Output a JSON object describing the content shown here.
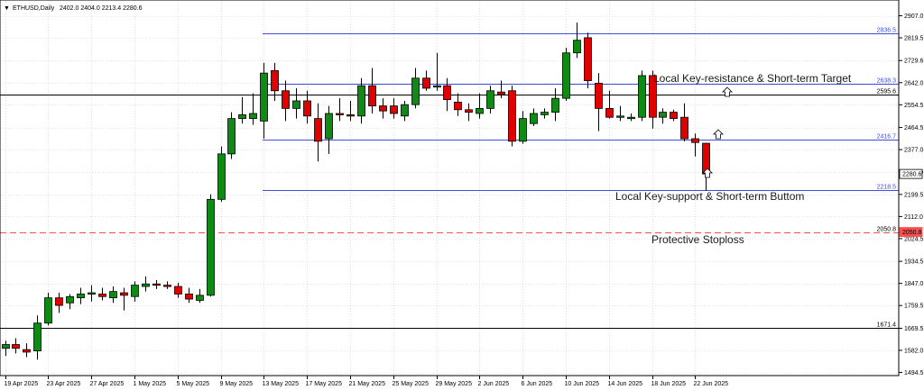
{
  "header": {
    "symbol_label": "ETHUSD,Daily",
    "ohlc_label": "2402.0 2404.0 2213.4 2280.6"
  },
  "chart_data": {
    "type": "candlestick",
    "symbol": "ETHUSD",
    "timeframe": "Daily",
    "ylim": [
      1471,
      2925
    ],
    "y_ticks": [
      2907.0,
      2819.5,
      2729.6,
      2642.0,
      2554.5,
      2464.5,
      2377.0,
      2289.5,
      2199.5,
      2112.0,
      2024.5,
      1934.5,
      1847.0,
      1759.5,
      1669.5,
      1582.0,
      1494.5
    ],
    "x_labels": [
      "19 Apr 2025",
      "23 Apr 2025",
      "27 Apr 2025",
      "1 May 2025",
      "5 May 2025",
      "9 May 2025",
      "13 May 2025",
      "17 May 2025",
      "21 May 2025",
      "25 May 2025",
      "29 May 2025",
      "2 Jun 2025",
      "6 Jun 2025",
      "10 Jun 2025",
      "14 Jun 2025",
      "18 Jun 2025",
      "22 Jun 2025"
    ],
    "candles": [
      {
        "date": "2025-04-18",
        "o": 1590,
        "h": 1620,
        "l": 1560,
        "c": 1605
      },
      {
        "date": "2025-04-19",
        "o": 1605,
        "h": 1630,
        "l": 1570,
        "c": 1590
      },
      {
        "date": "2025-04-20",
        "o": 1585,
        "h": 1610,
        "l": 1555,
        "c": 1575
      },
      {
        "date": "2025-04-21",
        "o": 1580,
        "h": 1720,
        "l": 1545,
        "c": 1690
      },
      {
        "date": "2025-04-22",
        "o": 1690,
        "h": 1810,
        "l": 1680,
        "c": 1790
      },
      {
        "date": "2025-04-23",
        "o": 1790,
        "h": 1810,
        "l": 1730,
        "c": 1760
      },
      {
        "date": "2025-04-24",
        "o": 1770,
        "h": 1805,
        "l": 1745,
        "c": 1795
      },
      {
        "date": "2025-04-25",
        "o": 1790,
        "h": 1830,
        "l": 1765,
        "c": 1805
      },
      {
        "date": "2025-04-26",
        "o": 1805,
        "h": 1840,
        "l": 1775,
        "c": 1810
      },
      {
        "date": "2025-04-27",
        "o": 1805,
        "h": 1830,
        "l": 1780,
        "c": 1795
      },
      {
        "date": "2025-04-28",
        "o": 1790,
        "h": 1835,
        "l": 1770,
        "c": 1815
      },
      {
        "date": "2025-04-29",
        "o": 1810,
        "h": 1830,
        "l": 1740,
        "c": 1800
      },
      {
        "date": "2025-04-30",
        "o": 1795,
        "h": 1855,
        "l": 1775,
        "c": 1840
      },
      {
        "date": "2025-05-01",
        "o": 1835,
        "h": 1875,
        "l": 1815,
        "c": 1845
      },
      {
        "date": "2025-05-02",
        "o": 1845,
        "h": 1860,
        "l": 1825,
        "c": 1840
      },
      {
        "date": "2025-05-03",
        "o": 1840,
        "h": 1855,
        "l": 1825,
        "c": 1835
      },
      {
        "date": "2025-05-04",
        "o": 1835,
        "h": 1850,
        "l": 1790,
        "c": 1805
      },
      {
        "date": "2025-05-05",
        "o": 1805,
        "h": 1830,
        "l": 1770,
        "c": 1785
      },
      {
        "date": "2025-05-06",
        "o": 1780,
        "h": 1825,
        "l": 1770,
        "c": 1800
      },
      {
        "date": "2025-05-07",
        "o": 1800,
        "h": 2200,
        "l": 1795,
        "c": 2180
      },
      {
        "date": "2025-05-08",
        "o": 2180,
        "h": 2390,
        "l": 2170,
        "c": 2360
      },
      {
        "date": "2025-05-09",
        "o": 2360,
        "h": 2525,
        "l": 2340,
        "c": 2500
      },
      {
        "date": "2025-05-10",
        "o": 2500,
        "h": 2585,
        "l": 2480,
        "c": 2515
      },
      {
        "date": "2025-05-11",
        "o": 2500,
        "h": 2600,
        "l": 2475,
        "c": 2520
      },
      {
        "date": "2025-05-12",
        "o": 2490,
        "h": 2720,
        "l": 2420,
        "c": 2680
      },
      {
        "date": "2025-05-13",
        "o": 2690,
        "h": 2720,
        "l": 2570,
        "c": 2610
      },
      {
        "date": "2025-05-14",
        "o": 2610,
        "h": 2650,
        "l": 2490,
        "c": 2540
      },
      {
        "date": "2025-05-15",
        "o": 2540,
        "h": 2620,
        "l": 2500,
        "c": 2570
      },
      {
        "date": "2025-05-16",
        "o": 2570,
        "h": 2610,
        "l": 2480,
        "c": 2510
      },
      {
        "date": "2025-05-17",
        "o": 2500,
        "h": 2560,
        "l": 2330,
        "c": 2410
      },
      {
        "date": "2025-05-18",
        "o": 2420,
        "h": 2550,
        "l": 2360,
        "c": 2520
      },
      {
        "date": "2025-05-19",
        "o": 2520,
        "h": 2580,
        "l": 2490,
        "c": 2515
      },
      {
        "date": "2025-05-20",
        "o": 2515,
        "h": 2570,
        "l": 2490,
        "c": 2510
      },
      {
        "date": "2025-05-21",
        "o": 2510,
        "h": 2660,
        "l": 2480,
        "c": 2630
      },
      {
        "date": "2025-05-22",
        "o": 2630,
        "h": 2700,
        "l": 2520,
        "c": 2550
      },
      {
        "date": "2025-05-23",
        "o": 2550,
        "h": 2580,
        "l": 2500,
        "c": 2530
      },
      {
        "date": "2025-05-24",
        "o": 2550,
        "h": 2580,
        "l": 2500,
        "c": 2520
      },
      {
        "date": "2025-05-25",
        "o": 2510,
        "h": 2570,
        "l": 2490,
        "c": 2555
      },
      {
        "date": "2025-05-26",
        "o": 2555,
        "h": 2700,
        "l": 2540,
        "c": 2660
      },
      {
        "date": "2025-05-27",
        "o": 2660,
        "h": 2690,
        "l": 2610,
        "c": 2620
      },
      {
        "date": "2025-05-28",
        "o": 2625,
        "h": 2760,
        "l": 2610,
        "c": 2630
      },
      {
        "date": "2025-05-29",
        "o": 2630,
        "h": 2660,
        "l": 2530,
        "c": 2575
      },
      {
        "date": "2025-05-30",
        "o": 2565,
        "h": 2600,
        "l": 2510,
        "c": 2535
      },
      {
        "date": "2025-05-31",
        "o": 2535,
        "h": 2560,
        "l": 2490,
        "c": 2525
      },
      {
        "date": "2025-06-01",
        "o": 2520,
        "h": 2600,
        "l": 2500,
        "c": 2540
      },
      {
        "date": "2025-06-02",
        "o": 2540,
        "h": 2630,
        "l": 2520,
        "c": 2610
      },
      {
        "date": "2025-06-03",
        "o": 2605,
        "h": 2650,
        "l": 2580,
        "c": 2595
      },
      {
        "date": "2025-06-04",
        "o": 2610,
        "h": 2630,
        "l": 2390,
        "c": 2410
      },
      {
        "date": "2025-06-05",
        "o": 2410,
        "h": 2530,
        "l": 2400,
        "c": 2500
      },
      {
        "date": "2025-06-06",
        "o": 2480,
        "h": 2540,
        "l": 2470,
        "c": 2520
      },
      {
        "date": "2025-06-07",
        "o": 2515,
        "h": 2540,
        "l": 2500,
        "c": 2525
      },
      {
        "date": "2025-06-08",
        "o": 2525,
        "h": 2620,
        "l": 2490,
        "c": 2580
      },
      {
        "date": "2025-06-09",
        "o": 2580,
        "h": 2780,
        "l": 2570,
        "c": 2760
      },
      {
        "date": "2025-06-10",
        "o": 2760,
        "h": 2880,
        "l": 2740,
        "c": 2810
      },
      {
        "date": "2025-06-11",
        "o": 2820,
        "h": 2840,
        "l": 2620,
        "c": 2650
      },
      {
        "date": "2025-06-12",
        "o": 2640,
        "h": 2680,
        "l": 2450,
        "c": 2540
      },
      {
        "date": "2025-06-13",
        "o": 2540,
        "h": 2610,
        "l": 2500,
        "c": 2505
      },
      {
        "date": "2025-06-14",
        "o": 2505,
        "h": 2550,
        "l": 2490,
        "c": 2510
      },
      {
        "date": "2025-06-15",
        "o": 2500,
        "h": 2520,
        "l": 2490,
        "c": 2505
      },
      {
        "date": "2025-06-16",
        "o": 2505,
        "h": 2690,
        "l": 2490,
        "c": 2670
      },
      {
        "date": "2025-06-17",
        "o": 2670,
        "h": 2690,
        "l": 2460,
        "c": 2505
      },
      {
        "date": "2025-06-18",
        "o": 2505,
        "h": 2540,
        "l": 2480,
        "c": 2525
      },
      {
        "date": "2025-06-19",
        "o": 2525,
        "h": 2535,
        "l": 2490,
        "c": 2500
      },
      {
        "date": "2025-06-20",
        "o": 2505,
        "h": 2560,
        "l": 2410,
        "c": 2420
      },
      {
        "date": "2025-06-21",
        "o": 2420,
        "h": 2440,
        "l": 2350,
        "c": 2405
      },
      {
        "date": "2025-06-22",
        "o": 2402,
        "h": 2404,
        "l": 2213.4,
        "c": 2280.6
      }
    ],
    "levels": [
      {
        "value": 2836.5,
        "label": "2836.5",
        "color": "#3f4fd8",
        "style": "solid"
      },
      {
        "value": 2638.3,
        "label": "2638.3",
        "color": "#3f4fd8",
        "style": "solid"
      },
      {
        "value": 2595.6,
        "label": "2595.6",
        "color": "#000000",
        "style": "solid"
      },
      {
        "value": 2416.7,
        "label": "2416.7",
        "color": "#3f4fd8",
        "style": "solid"
      },
      {
        "value": 2218.5,
        "label": "2218.5",
        "color": "#3f4fd8",
        "style": "solid"
      },
      {
        "value": 2050.8,
        "label": "2050.8",
        "color": "#ff4d4d",
        "style": "dashed"
      },
      {
        "value": 1671.4,
        "label": "1671.4",
        "color": "#000000",
        "style": "solid"
      }
    ],
    "current_price_label": "2280.6",
    "annotations": [
      {
        "text": "Local Key-resistance & Short-term Target"
      },
      {
        "text": "Local Key-support & Short-term Buttom"
      },
      {
        "text": "Protective Stoploss"
      }
    ],
    "colors": {
      "bull": "#0f8a14",
      "bear": "#e00000",
      "grid": "#c8c8c8"
    },
    "grid": true
  }
}
